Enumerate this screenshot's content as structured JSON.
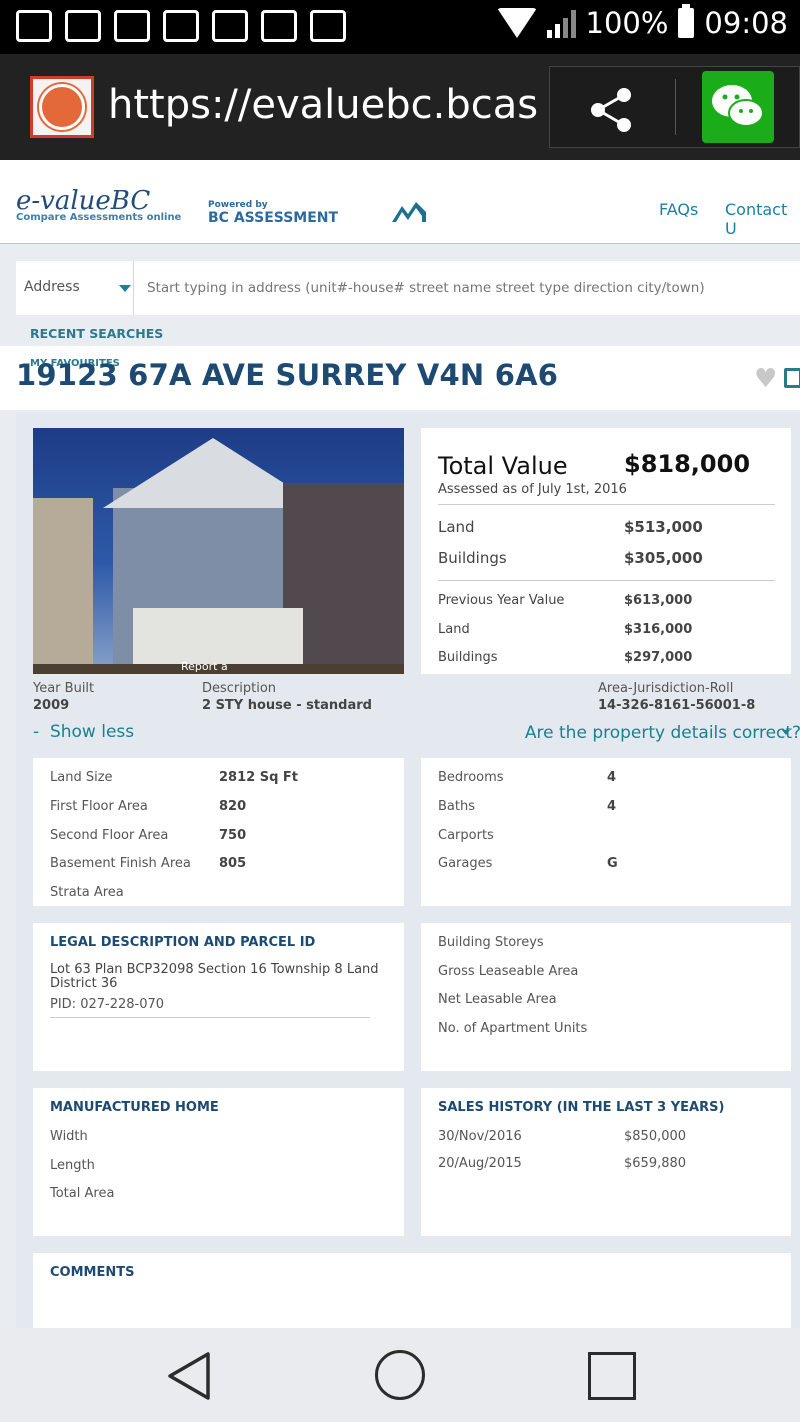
{
  "status_bar": {
    "battery": "100%",
    "time": "09:08"
  },
  "browser": {
    "url": "https://evaluebc.bcass..",
    "share_icon": "share-icon",
    "wechat_icon": "wechat-icon"
  },
  "header": {
    "logo_title": "e-valueBC",
    "logo_subtitle": "Compare Assessments online",
    "powered_label": "Powered by",
    "bc_assessment": "BC ASSESSMENT",
    "nav": [
      "FAQs",
      "Contact U"
    ]
  },
  "search": {
    "select_value": "Address",
    "placeholder": "Start typing in address (unit#-house# street name street type direction city/town)"
  },
  "recent_searches": "RECENT SEARCHES",
  "my_favourites": "MY FAVOURITES",
  "property": {
    "address": "19123 67A AVE SURREY V4N 6A6",
    "photo_caption": "Report a",
    "year_built_label": "Year Built",
    "year_built": "2009",
    "description_label": "Description",
    "description": "2 STY house - standard",
    "roll_label": "Area-Jurisdiction-Roll",
    "roll": "14-326-8161-56001-8",
    "show_less": "Show less",
    "correct_question": "Are the property details correct?"
  },
  "values": {
    "total_label": "Total Value",
    "total": "$818,000",
    "assessed_date": "Assessed as of July 1st, 2016",
    "land_label": "Land",
    "land": "$513,000",
    "buildings_label": "Buildings",
    "buildings": "$305,000",
    "previous_label": "Previous Year Value",
    "previous": "$613,000",
    "prev_land_label": "Land",
    "prev_land": "$316,000",
    "prev_buildings_label": "Buildings",
    "prev_buildings": "$297,000"
  },
  "details_left": [
    {
      "label": "Land Size",
      "value": "2812 Sq Ft"
    },
    {
      "label": "First Floor Area",
      "value": "820"
    },
    {
      "label": "Second Floor Area",
      "value": "750"
    },
    {
      "label": "Basement Finish Area",
      "value": "805"
    },
    {
      "label": "Strata Area",
      "value": ""
    }
  ],
  "details_right": [
    {
      "label": "Bedrooms",
      "value": "4"
    },
    {
      "label": "Baths",
      "value": "4"
    },
    {
      "label": "Carports",
      "value": ""
    },
    {
      "label": "Garages",
      "value": "G"
    }
  ],
  "legal": {
    "title": "LEGAL DESCRIPTION AND PARCEL ID",
    "text": "Lot 63 Plan BCP32098 Section 16 Township 8 Land District 36",
    "pid": "PID: 027-228-070"
  },
  "building": [
    "Building Storeys",
    "Gross Leaseable Area",
    "Net Leasable Area",
    "No. of Apartment Units"
  ],
  "manufactured": {
    "title": "MANUFACTURED HOME",
    "rows": [
      "Width",
      "Length",
      "Total Area"
    ]
  },
  "sales": {
    "title": "SALES HISTORY (IN THE LAST 3 YEARS)",
    "rows": [
      {
        "date": "30/Nov/2016",
        "price": "$850,000"
      },
      {
        "date": "20/Aug/2015",
        "price": "$659,880"
      }
    ]
  },
  "comments_title": "COMMENTS"
}
